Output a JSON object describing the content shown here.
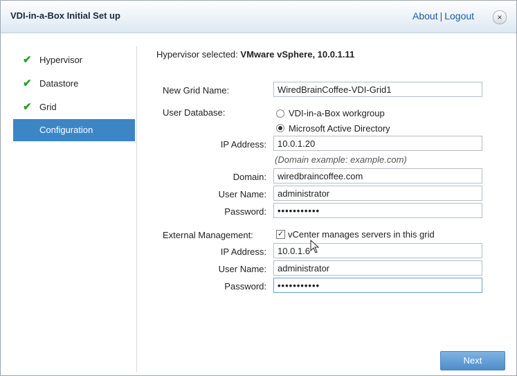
{
  "window": {
    "title": "VDI-in-a-Box Initial Set up",
    "about_link": "About",
    "separator": "|",
    "logout_link": "Logout",
    "close_glyph": "×"
  },
  "sidebar": {
    "steps": [
      {
        "label": "Hypervisor",
        "done": true,
        "check": "✔"
      },
      {
        "label": "Datastore",
        "done": true,
        "check": "✔"
      },
      {
        "label": "Grid",
        "done": true,
        "check": "✔"
      },
      {
        "label": "Configuration",
        "done": false,
        "active": true
      }
    ]
  },
  "header": {
    "label": "Hypervisor selected:",
    "value": "VMware vSphere, 10.0.1.11"
  },
  "form": {
    "grid_name_label": "New Grid Name:",
    "grid_name_value": "WiredBrainCoffee-VDI-Grid1",
    "user_db_label": "User Database:",
    "user_db_options": [
      {
        "label": "VDI-in-a-Box workgroup",
        "selected": false
      },
      {
        "label": "Microsoft Active Directory",
        "selected": true
      }
    ],
    "ad_ip_label": "IP Address:",
    "ad_ip_value": "10.0.1.20",
    "domain_hint": "(Domain example: example.com)",
    "domain_label": "Domain:",
    "domain_value": "wiredbraincoffee.com",
    "ad_user_label": "User Name:",
    "ad_user_value": "administrator",
    "ad_password_label": "Password:",
    "ad_password_value": "•••••••••••",
    "ext_mgmt_label": "External Management:",
    "vcenter_checkbox_label": "vCenter manages servers in this grid",
    "vcenter_checked": true,
    "vc_ip_label": "IP Address:",
    "vc_ip_value": "10.0.1.6",
    "vc_user_label": "User Name:",
    "vc_user_value": "administrator",
    "vc_password_label": "Password:",
    "vc_password_value": "•••••••••••"
  },
  "footer": {
    "next_label": "Next"
  },
  "icons": {
    "step_done": "check-icon",
    "close": "close-icon"
  },
  "colors": {
    "accent": "#3d86c6",
    "check": "#2c9a2c",
    "link": "#1a5aa6"
  }
}
